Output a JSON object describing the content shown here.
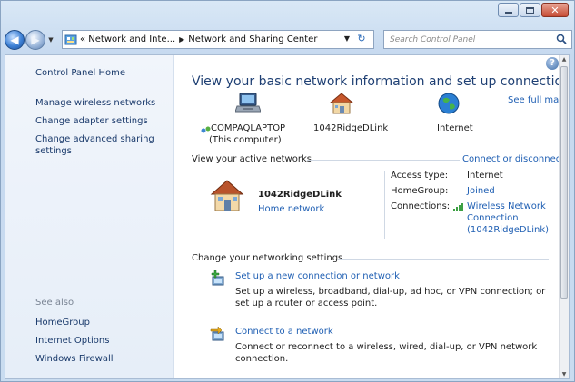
{
  "window": {
    "address": {
      "crumbs": [
        "« Network and Inte...",
        "Network and Sharing Center"
      ]
    },
    "search": {
      "placeholder": "Search Control Panel"
    }
  },
  "sidebar": {
    "home": "Control Panel Home",
    "links": [
      "Manage wireless networks",
      "Change adapter settings",
      "Change advanced sharing settings"
    ],
    "see_also_heading": "See also",
    "see_also": [
      "HomeGroup",
      "Internet Options",
      "Windows Firewall"
    ]
  },
  "main": {
    "title": "View your basic network information and set up connections",
    "see_full_map": "See full map",
    "map": {
      "computer_name": "COMPAQLAPTOP",
      "computer_sub": "(This computer)",
      "network_name": "1042RidgeDLink",
      "internet": "Internet"
    },
    "active_networks": {
      "heading": "View your active networks",
      "connect_link": "Connect or disconnect",
      "network_name": "1042RidgeDLink",
      "network_type": "Home network",
      "access_type_label": "Access type:",
      "access_type_value": "Internet",
      "homegroup_label": "HomeGroup:",
      "homegroup_value": "Joined",
      "connections_label": "Connections:",
      "connections_value_lines": [
        "Wireless Network",
        "Connection",
        "(1042RidgeDLink)"
      ]
    },
    "settings": {
      "heading": "Change your networking settings",
      "tasks": [
        {
          "title": "Set up a new connection or network",
          "desc": "Set up a wireless, broadband, dial-up, ad hoc, or VPN connection; or set up a router or access point."
        },
        {
          "title": "Connect to a network",
          "desc": "Connect or reconnect to a wireless, wired, dial-up, or VPN network connection."
        }
      ]
    }
  },
  "colors": {
    "link": "#1f5fb3",
    "title": "#1e3f73",
    "sidebar_link": "#1a3a6b"
  }
}
